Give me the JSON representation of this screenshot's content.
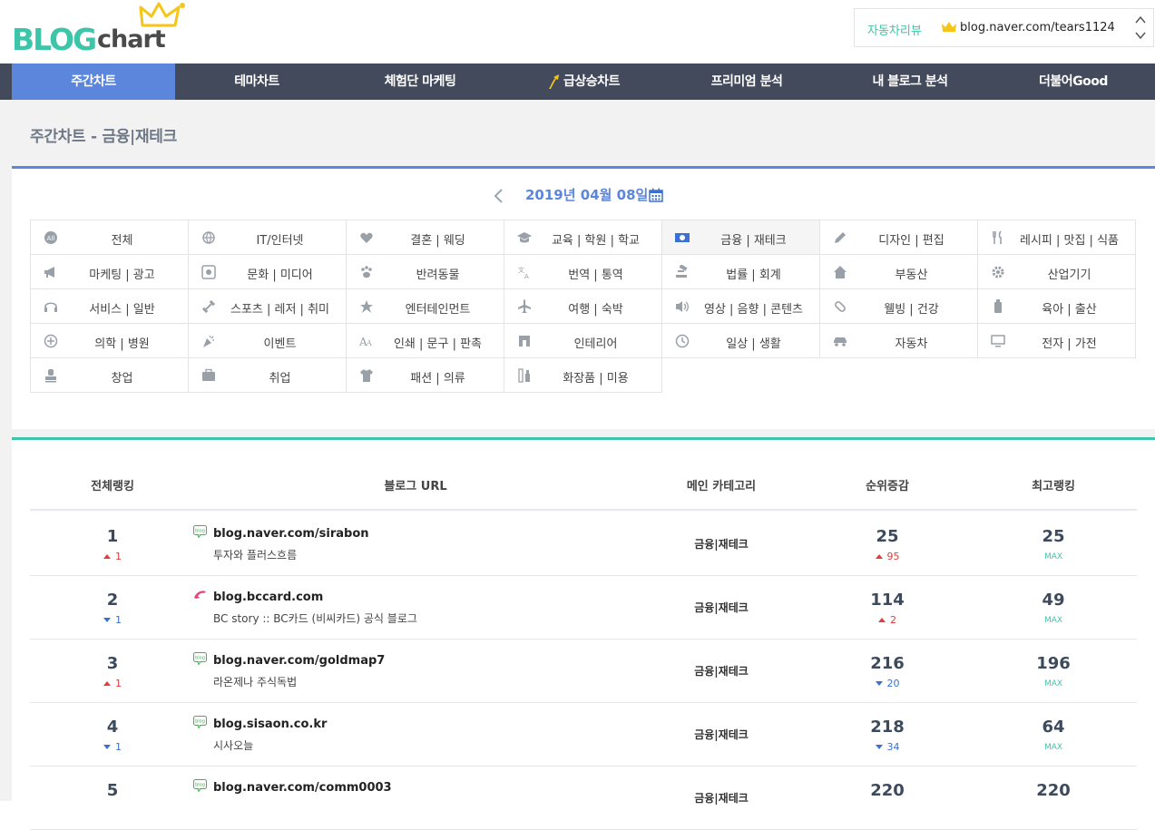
{
  "logo": {
    "blog": "BLOG",
    "chart": "chart"
  },
  "autobox": {
    "label": "자동차리뷰",
    "url": "blog.naver.com/tears1124"
  },
  "nav": [
    {
      "label": "주간차트",
      "active": true
    },
    {
      "label": "테마차트",
      "active": false
    },
    {
      "label": "체험단 마케팅",
      "active": false
    },
    {
      "label": "급상승차트",
      "active": false
    },
    {
      "label": "프리미엄 분석",
      "active": false
    },
    {
      "label": "내 블로그 분석",
      "active": false
    },
    {
      "label": "더불어Good",
      "active": false
    }
  ],
  "page_title": "주간차트 - 금융|재테크",
  "date": "2019년 04월 08일",
  "categories": [
    {
      "label": "전체",
      "icon": "all-icon"
    },
    {
      "label": "IT/인터넷",
      "icon": "globe-icon"
    },
    {
      "label": "결혼 | 웨딩",
      "icon": "heart-icon"
    },
    {
      "label": "교육 | 학원 | 학교",
      "icon": "graduation-cap-icon"
    },
    {
      "label": "금융 | 재테크",
      "icon": "money-icon",
      "active": true
    },
    {
      "label": "디자인 | 편집",
      "icon": "pencil-icon"
    },
    {
      "label": "레시피 | 맛집 | 식품",
      "icon": "utensils-icon"
    },
    {
      "label": "마케팅 | 광고",
      "icon": "megaphone-icon"
    },
    {
      "label": "문화 | 미디어",
      "icon": "media-icon"
    },
    {
      "label": "반려동물",
      "icon": "paw-icon"
    },
    {
      "label": "번역 | 통역",
      "icon": "translate-icon"
    },
    {
      "label": "법률 | 회계",
      "icon": "gavel-icon"
    },
    {
      "label": "부동산",
      "icon": "home-icon"
    },
    {
      "label": "산업기기",
      "icon": "gear-icon"
    },
    {
      "label": "서비스 | 일반",
      "icon": "headset-icon"
    },
    {
      "label": "스포츠 | 레저 | 취미",
      "icon": "dumbbell-icon"
    },
    {
      "label": "엔터테인먼트",
      "icon": "star-icon"
    },
    {
      "label": "여행 | 숙박",
      "icon": "plane-icon"
    },
    {
      "label": "영상 | 음향 | 콘텐츠",
      "icon": "speaker-icon"
    },
    {
      "label": "웰빙 | 건강",
      "icon": "pill-icon"
    },
    {
      "label": "육아 | 출산",
      "icon": "bottle-icon"
    },
    {
      "label": "의학 | 병원",
      "icon": "plus-circle-icon"
    },
    {
      "label": "이벤트",
      "icon": "party-icon"
    },
    {
      "label": "인쇄 | 문구 | 판촉",
      "icon": "font-icon"
    },
    {
      "label": "인테리어",
      "icon": "interior-icon"
    },
    {
      "label": "일상 | 생활",
      "icon": "clock-icon"
    },
    {
      "label": "자동차",
      "icon": "car-icon"
    },
    {
      "label": "전자 | 가전",
      "icon": "monitor-icon"
    },
    {
      "label": "창업",
      "icon": "stamp-icon"
    },
    {
      "label": "취업",
      "icon": "briefcase-icon"
    },
    {
      "label": "패션 | 의류",
      "icon": "shirt-icon"
    },
    {
      "label": "화장품 | 미용",
      "icon": "cosmetics-icon"
    }
  ],
  "table": {
    "headers": [
      "전체랭킹",
      "블로그 URL",
      "메인 카테고리",
      "순위증감",
      "최고랭킹"
    ],
    "rows": [
      {
        "rank": "1",
        "rank_change": "1",
        "rank_dir": "up",
        "icon": "naver-blog-icon",
        "url": "blog.naver.com/sirabon",
        "name": "투자와 플러스흐름",
        "category": "금융|재테크",
        "change": "25",
        "change_sub": "95",
        "change_dir": "up",
        "best": "25",
        "best_label": "MAX"
      },
      {
        "rank": "2",
        "rank_change": "1",
        "rank_dir": "down",
        "icon": "dolphin-icon",
        "url": "blog.bccard.com",
        "name": "BC story :: BC카드 (비씨카드) 공식 블로그",
        "category": "금융|재테크",
        "change": "114",
        "change_sub": "2",
        "change_dir": "up",
        "best": "49",
        "best_label": "MAX"
      },
      {
        "rank": "3",
        "rank_change": "1",
        "rank_dir": "up",
        "icon": "naver-blog-icon",
        "url": "blog.naver.com/goldmap7",
        "name": "라온제나 주식독법",
        "category": "금융|재테크",
        "change": "216",
        "change_sub": "20",
        "change_dir": "down",
        "best": "196",
        "best_label": "MAX"
      },
      {
        "rank": "4",
        "rank_change": "1",
        "rank_dir": "down",
        "icon": "naver-blog-icon",
        "url": "blog.sisaon.co.kr",
        "name": "시사오늘",
        "category": "금융|재테크",
        "change": "218",
        "change_sub": "34",
        "change_dir": "down",
        "best": "64",
        "best_label": "MAX"
      },
      {
        "rank": "5",
        "rank_change": "",
        "rank_dir": "",
        "icon": "naver-blog-icon",
        "url": "blog.naver.com/comm0003",
        "name": "",
        "category": "금융|재테크",
        "change": "220",
        "change_sub": "",
        "change_dir": "",
        "best": "220",
        "best_label": ""
      }
    ]
  },
  "colors": {
    "nav_bg": "#434a5c",
    "nav_active": "#5b86db",
    "accent_green": "#3cc5a8",
    "accent_blue": "#5b86db",
    "up": "#e23b3b",
    "down": "#3b6fd1"
  }
}
